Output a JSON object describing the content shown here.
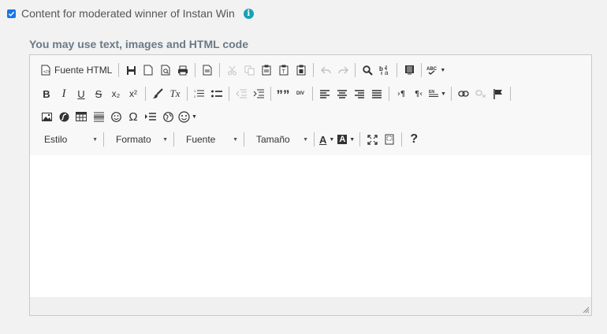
{
  "checkbox": {
    "checked": true,
    "label": "Content for moderated winner of Instan Win",
    "info_glyph": "i"
  },
  "hint": "You may use text, images and HTML code",
  "toolbar": {
    "source_label": "Fuente HTML",
    "bold": "B",
    "italic": "I",
    "underline": "U",
    "strike": "S",
    "subscript": "x₂",
    "superscript": "x²",
    "clear_format": "Tx",
    "blockquote": "””",
    "div": "DIV",
    "omega": "Ω",
    "help": "?",
    "combos": {
      "style": "Estilo",
      "format": "Formato",
      "font": "Fuente",
      "size": "Tamaño"
    },
    "text_color": "A",
    "bg_color": "A"
  },
  "colors": {
    "accent": "#1a73e8",
    "info": "#17a2b8"
  }
}
